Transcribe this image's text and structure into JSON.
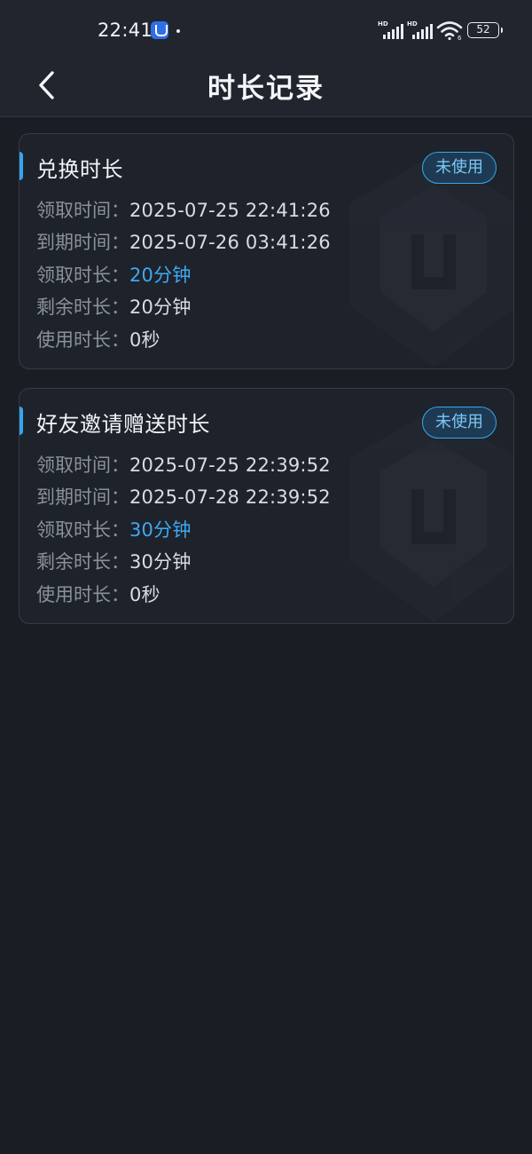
{
  "status_bar": {
    "time": "22:41",
    "battery": "52",
    "network_labels": [
      "HD",
      "HD"
    ],
    "icons": [
      "app-notification-icon",
      "signal-hd-icon",
      "signal-hd-icon",
      "wifi-icon",
      "battery-icon"
    ]
  },
  "nav": {
    "back_icon": "chevron-left-icon",
    "title": "时长记录"
  },
  "colors": {
    "background": "#1a1d24",
    "accent": "#37a5f0",
    "highlight_value": "#3ea9f5",
    "label": "#8b919b",
    "value": "#d8dce3"
  },
  "records": [
    {
      "title": "兑换时长",
      "status": "未使用",
      "fields": [
        {
          "label": "领取时间：",
          "value": "2025-07-25 22:41:26",
          "highlight": false
        },
        {
          "label": "到期时间：",
          "value": "2025-07-26 03:41:26",
          "highlight": false
        },
        {
          "label": "领取时长：",
          "value": "20分钟",
          "highlight": true
        },
        {
          "label": "剩余时长：",
          "value": "20分钟",
          "highlight": false
        },
        {
          "label": "使用时长：",
          "value": "0秒",
          "highlight": false
        }
      ]
    },
    {
      "title": "好友邀请赠送时长",
      "status": "未使用",
      "fields": [
        {
          "label": "领取时间：",
          "value": "2025-07-25 22:39:52",
          "highlight": false
        },
        {
          "label": "到期时间：",
          "value": "2025-07-28 22:39:52",
          "highlight": false
        },
        {
          "label": "领取时长：",
          "value": "30分钟",
          "highlight": true
        },
        {
          "label": "剩余时长：",
          "value": "30分钟",
          "highlight": false
        },
        {
          "label": "使用时长：",
          "value": "0秒",
          "highlight": false
        }
      ]
    }
  ]
}
